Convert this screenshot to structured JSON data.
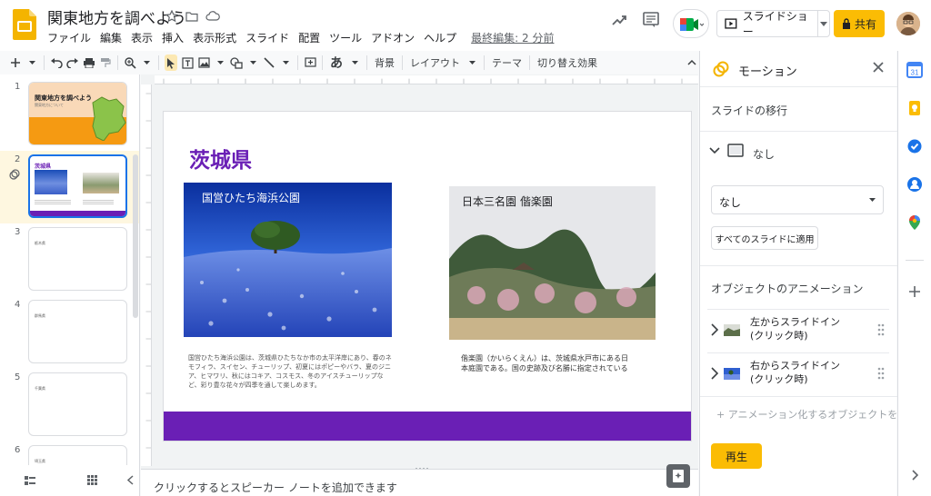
{
  "header": {
    "doc_title": "関東地方を調べよう",
    "menu": [
      "ファイル",
      "編集",
      "表示",
      "挿入",
      "表示形式",
      "スライド",
      "配置",
      "ツール",
      "アドオン",
      "ヘルプ"
    ],
    "last_edit": "最終編集: 2 分前",
    "slideshow_label": "スライドショー",
    "share_label": "共有"
  },
  "toolbar": {
    "background_label": "背景",
    "layout_label": "レイアウト",
    "theme_label": "テーマ",
    "transition_label": "切り替え効果",
    "text_glyph": "あ"
  },
  "filmstrip": {
    "slides": [
      {
        "num": "1",
        "title": "関東地方を調べよう",
        "sub": "関東地方について"
      },
      {
        "num": "2",
        "title": "茨城県"
      },
      {
        "num": "3",
        "title": "栃木県"
      },
      {
        "num": "4",
        "title": "群馬県"
      },
      {
        "num": "5",
        "title": "千葉県"
      },
      {
        "num": "6",
        "title": "埼玉県"
      }
    ]
  },
  "slide": {
    "title": "茨城県",
    "left_caption": "国営ひたち海浜公園",
    "right_caption": "日本三名園 偕楽園",
    "left_body": "国営ひたち海浜公園は、茨城県ひたちなか市の太平洋岸にあり、春のネモフィラ、スイセン、チューリップ、初夏にはポピーやバラ、夏のジニア、ヒマワリ、秋にはコキア、コスモス、冬のアイスチューリップなど、彩り豊な花々が四季を通して楽しめます。",
    "right_body": "偕楽園（かいらくえん）は、茨城県水戸市にある日本庭園である。国の史跡及び名勝に指定されている"
  },
  "notes": {
    "placeholder": "クリックするとスピーカー ノートを追加できます"
  },
  "motion_panel": {
    "title": "モーション",
    "transition_section": "スライドの移行",
    "transition_value": "なし",
    "transition_select": "なし",
    "apply_all": "すべてのスライドに適用",
    "object_section": "オブジェクトのアニメーション",
    "animations": [
      {
        "line1": "左からスライドイン",
        "line2": "(クリック時)"
      },
      {
        "line1": "右からスライドイン",
        "line2": "(クリック時)"
      }
    ],
    "add_animation": "アニメーション化するオブジェクトを選",
    "play_label": "再生"
  },
  "colors": {
    "accent_purple": "#6a1fb5",
    "brand_yellow": "#fbbc04",
    "selection_blue": "#1a73e8"
  }
}
